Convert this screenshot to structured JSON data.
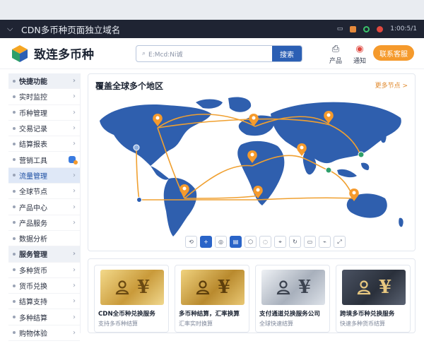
{
  "browser": {
    "title": "CDN多币种页面独立域名",
    "status_text": "1:00:5/1"
  },
  "header": {
    "brand": "致连多币种",
    "search_placeholder": "E:Mcd:Ni诚",
    "search_button": "搜索",
    "icon1_label": "产品",
    "icon2_label": "通知",
    "cta_label": "联系客服"
  },
  "sidebar": {
    "items": [
      {
        "label": "快捷功能",
        "kind": "section"
      },
      {
        "label": "实时监控",
        "kind": "item"
      },
      {
        "label": "币种管理",
        "kind": "item"
      },
      {
        "label": "交易记录",
        "kind": "item"
      },
      {
        "label": "结算报表",
        "kind": "item"
      },
      {
        "label": "营销工具",
        "kind": "item-badge"
      },
      {
        "label": "流量管理",
        "kind": "active"
      },
      {
        "label": "全球节点",
        "kind": "item"
      },
      {
        "label": "产品中心",
        "kind": "item"
      },
      {
        "label": "产品服务",
        "kind": "item"
      },
      {
        "label": "数据分析",
        "kind": "plain"
      },
      {
        "label": "服务管理",
        "kind": "section"
      },
      {
        "label": "多种货币",
        "kind": "item"
      },
      {
        "label": "货币兑换",
        "kind": "item"
      },
      {
        "label": "结算支持",
        "kind": "item"
      },
      {
        "label": "多种结算",
        "kind": "item"
      },
      {
        "label": "购物体验",
        "kind": "item"
      }
    ]
  },
  "map_panel": {
    "title": "覆盖全球多个地区",
    "more": "更多节点 >",
    "toolbar": [
      "⟲",
      "+",
      "◎",
      "▤",
      "⬡",
      "◌",
      "⌖",
      "↻",
      "▭",
      "⌁",
      "⤢"
    ]
  },
  "cards": [
    {
      "title": "CDN全币种兑换服务",
      "subtitle": "支持多币种结算",
      "theme": "gold"
    },
    {
      "title": "多币种结算，汇率换算",
      "subtitle": "汇率实时换算",
      "theme": "gold2"
    },
    {
      "title": "支付通道兑换服务公司",
      "subtitle": "全球快速结算",
      "theme": "silver"
    },
    {
      "title": "跨境多币种兑换服务",
      "subtitle": "快速多种货币结算",
      "theme": "dark"
    }
  ],
  "colors": {
    "primary": "#2b5fb4",
    "accent": "#f59a2c",
    "map_land": "#2f5fae",
    "route": "#f0a030"
  }
}
